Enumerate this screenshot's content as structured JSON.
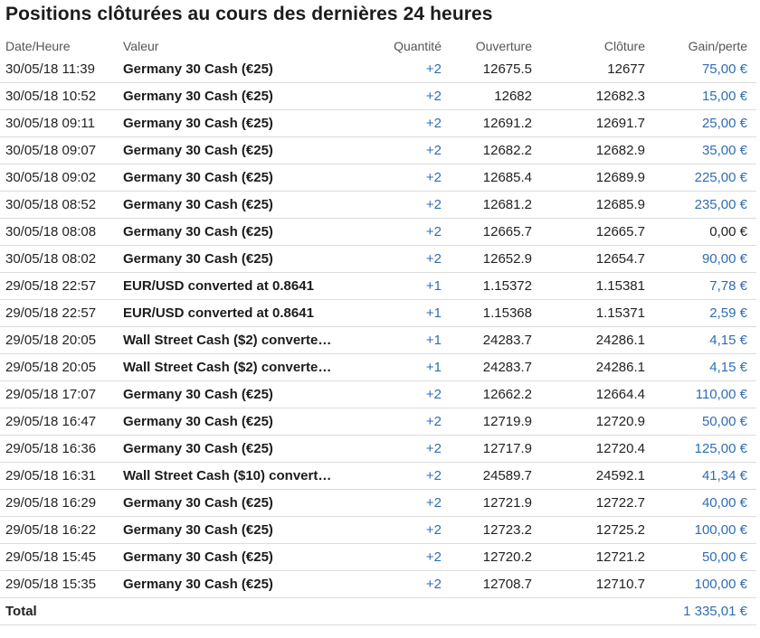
{
  "title": "Positions clôturées au cours des dernières 24 heures",
  "columns": {
    "date": "Date/Heure",
    "valeur": "Valeur",
    "quantite": "Quantité",
    "ouverture": "Ouverture",
    "cloture": "Clôture",
    "gain": "Gain/perte"
  },
  "rows": [
    {
      "date": "30/05/18 11:39",
      "valeur": "Germany 30 Cash (€25)",
      "quantite": "+2",
      "ouverture": "12675.5",
      "cloture": "12677",
      "gain": "75,00 €"
    },
    {
      "date": "30/05/18 10:52",
      "valeur": "Germany 30 Cash (€25)",
      "quantite": "+2",
      "ouverture": "12682",
      "cloture": "12682.3",
      "gain": "15,00 €"
    },
    {
      "date": "30/05/18 09:11",
      "valeur": "Germany 30 Cash (€25)",
      "quantite": "+2",
      "ouverture": "12691.2",
      "cloture": "12691.7",
      "gain": "25,00 €"
    },
    {
      "date": "30/05/18 09:07",
      "valeur": "Germany 30 Cash (€25)",
      "quantite": "+2",
      "ouverture": "12682.2",
      "cloture": "12682.9",
      "gain": "35,00 €"
    },
    {
      "date": "30/05/18 09:02",
      "valeur": "Germany 30 Cash (€25)",
      "quantite": "+2",
      "ouverture": "12685.4",
      "cloture": "12689.9",
      "gain": "225,00 €"
    },
    {
      "date": "30/05/18 08:52",
      "valeur": "Germany 30 Cash (€25)",
      "quantite": "+2",
      "ouverture": "12681.2",
      "cloture": "12685.9",
      "gain": "235,00 €"
    },
    {
      "date": "30/05/18 08:08",
      "valeur": "Germany 30 Cash (€25)",
      "quantite": "+2",
      "ouverture": "12665.7",
      "cloture": "12665.7",
      "gain": "0,00 €",
      "zero": true
    },
    {
      "date": "30/05/18 08:02",
      "valeur": "Germany 30 Cash (€25)",
      "quantite": "+2",
      "ouverture": "12652.9",
      "cloture": "12654.7",
      "gain": "90,00 €"
    },
    {
      "date": "29/05/18 22:57",
      "valeur": "EUR/USD converted at 0.8641",
      "quantite": "+1",
      "ouverture": "1.15372",
      "cloture": "1.15381",
      "gain": "7,78 €"
    },
    {
      "date": "29/05/18 22:57",
      "valeur": "EUR/USD converted at 0.8641",
      "quantite": "+1",
      "ouverture": "1.15368",
      "cloture": "1.15371",
      "gain": "2,59 €"
    },
    {
      "date": "29/05/18 20:05",
      "valeur": "Wall Street Cash ($2) converte…",
      "quantite": "+1",
      "ouverture": "24283.7",
      "cloture": "24286.1",
      "gain": "4,15 €"
    },
    {
      "date": "29/05/18 20:05",
      "valeur": "Wall Street Cash ($2) converte…",
      "quantite": "+1",
      "ouverture": "24283.7",
      "cloture": "24286.1",
      "gain": "4,15 €"
    },
    {
      "date": "29/05/18 17:07",
      "valeur": "Germany 30 Cash (€25)",
      "quantite": "+2",
      "ouverture": "12662.2",
      "cloture": "12664.4",
      "gain": "110,00 €"
    },
    {
      "date": "29/05/18 16:47",
      "valeur": "Germany 30 Cash (€25)",
      "quantite": "+2",
      "ouverture": "12719.9",
      "cloture": "12720.9",
      "gain": "50,00 €"
    },
    {
      "date": "29/05/18 16:36",
      "valeur": "Germany 30 Cash (€25)",
      "quantite": "+2",
      "ouverture": "12717.9",
      "cloture": "12720.4",
      "gain": "125,00 €"
    },
    {
      "date": "29/05/18 16:31",
      "valeur": "Wall Street Cash ($10) convert…",
      "quantite": "+2",
      "ouverture": "24589.7",
      "cloture": "24592.1",
      "gain": "41,34 €"
    },
    {
      "date": "29/05/18 16:29",
      "valeur": "Germany 30 Cash (€25)",
      "quantite": "+2",
      "ouverture": "12721.9",
      "cloture": "12722.7",
      "gain": "40,00 €"
    },
    {
      "date": "29/05/18 16:22",
      "valeur": "Germany 30 Cash (€25)",
      "quantite": "+2",
      "ouverture": "12723.2",
      "cloture": "12725.2",
      "gain": "100,00 €"
    },
    {
      "date": "29/05/18 15:45",
      "valeur": "Germany 30 Cash (€25)",
      "quantite": "+2",
      "ouverture": "12720.2",
      "cloture": "12721.2",
      "gain": "50,00 €"
    },
    {
      "date": "29/05/18 15:35",
      "valeur": "Germany 30 Cash (€25)",
      "quantite": "+2",
      "ouverture": "12708.7",
      "cloture": "12710.7",
      "gain": "100,00 €"
    }
  ],
  "total": {
    "label": "Total",
    "gain": "1 335,01 €"
  },
  "colors": {
    "accent": "#2f6db3",
    "text": "#222222",
    "divider": "#dcdcdc"
  }
}
